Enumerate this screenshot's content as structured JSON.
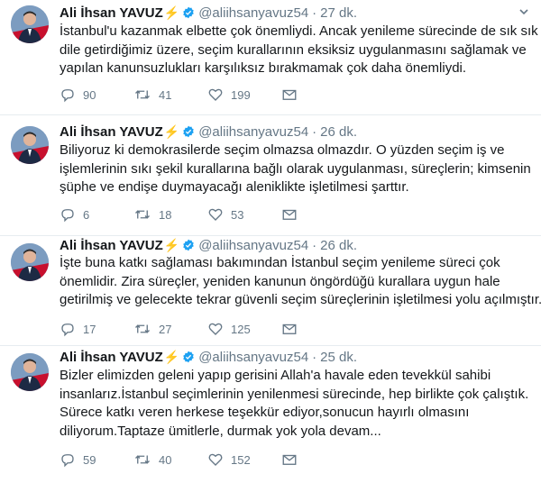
{
  "author": {
    "name": "Ali İhsan YAVUZ",
    "emoji": "⚡",
    "handle": "@aliihsanyavuz54",
    "separator": "·"
  },
  "tweets": [
    {
      "time": "27 dk.",
      "lines": [
        "İstanbul'u kazanmak elbette çok önemliydi. Ancak yenileme sürecinde de sık sık",
        "dile getirdiğimiz üzere, seçim kurallarının eksiksiz uygulanmasını sağlamak ve",
        "yapılan kanunsuzlukları karşılıksız bırakmamak çok daha önemliydi."
      ],
      "replies": "90",
      "retweets": "41",
      "likes": "199"
    },
    {
      "time": "26 dk.",
      "lines": [
        "Biliyoruz ki demokrasilerde seçim  olmazsa olmazdır. O yüzden seçim iş ve",
        "işlemlerinin sıkı şekil kurallarına bağlı olarak uygulanması, süreçlerin; kimsenin",
        "şüphe ve endişe duymayacağı aleniklikte işletilmesi şarttır."
      ],
      "replies": "6",
      "retweets": "18",
      "likes": "53"
    },
    {
      "time": "26 dk.",
      "lines": [
        "İşte buna katkı sağlaması bakımından İstanbul seçim yenileme süreci çok",
        "önemlidir. Zira süreçler, yeniden kanunun öngördüğü kurallara uygun hale",
        "getirilmiş ve gelecekte tekrar güvenli seçim süreçlerinin işletilmesi yolu açılmıştır."
      ],
      "replies": "17",
      "retweets": "27",
      "likes": "125"
    },
    {
      "time": "25 dk.",
      "lines": [
        "Bizler elimizden geleni yapıp gerisini Allah'a havale eden tevekkül sahibi",
        "insanlarız.İstanbul seçimlerinin yenilenmesi sürecinde, hep birlikte çok çalıştık.",
        "Sürece katkı veren herkese teşekkür ediyor,sonucun hayırlı olmasını",
        "diliyorum.Taptaze ümitlerle, durmak yok yola devam..."
      ],
      "replies": "59",
      "retweets": "40",
      "likes": "152"
    }
  ],
  "colors": {
    "text": "#14171a",
    "muted": "#657786",
    "verified": "#1da1f2",
    "bolt": "#f4a300",
    "border": "#e6ecf0"
  },
  "icons": {
    "verified": "verified-badge-icon",
    "caret": "chevron-down-icon",
    "reply": "reply-icon",
    "retweet": "retweet-icon",
    "like": "heart-icon",
    "dm": "envelope-icon"
  }
}
